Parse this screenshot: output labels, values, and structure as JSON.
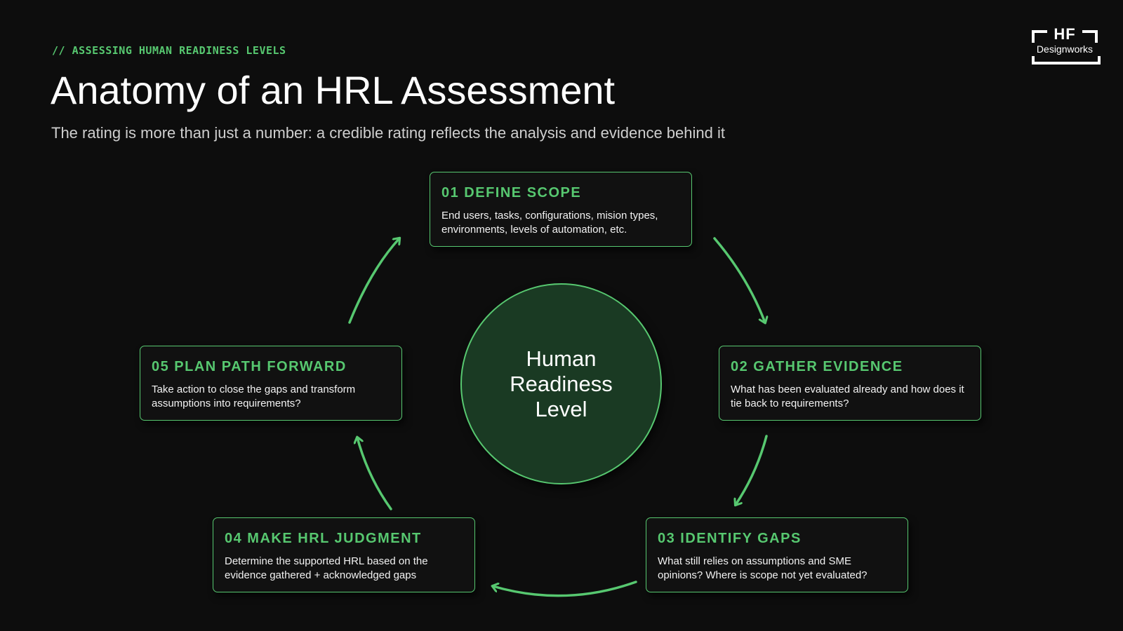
{
  "header": {
    "eyebrow": "// ASSESSING HUMAN READINESS LEVELS",
    "title": "Anatomy of an HRL Assessment",
    "subtitle": "The rating is more than just a number: a credible rating reflects the analysis and evidence behind it"
  },
  "logo": {
    "line1": "HF",
    "line2": "Designworks"
  },
  "hub": {
    "label": "Human Readiness Level"
  },
  "steps": [
    {
      "title": "01 DEFINE SCOPE",
      "description": "End users, tasks, configurations, mision types, environments, levels of automation, etc."
    },
    {
      "title": "02 GATHER EVIDENCE",
      "description": "What has been evaluated already and how does it tie back to requirements?"
    },
    {
      "title": "03 IDENTIFY GAPS",
      "description": "What still relies on assumptions and SME opinions? Where is scope not yet evaluated?"
    },
    {
      "title": "04 MAKE HRL JUDGMENT",
      "description": "Determine the supported HRL based on the evidence gathered + acknowledged gaps"
    },
    {
      "title": "05 PLAN PATH FORWARD",
      "description": "Take action to close the gaps and transform assumptions into requirements?"
    }
  ],
  "colors": {
    "accent": "#57c870",
    "background": "#0d0d0d",
    "hub_fill": "#1a3a23"
  }
}
